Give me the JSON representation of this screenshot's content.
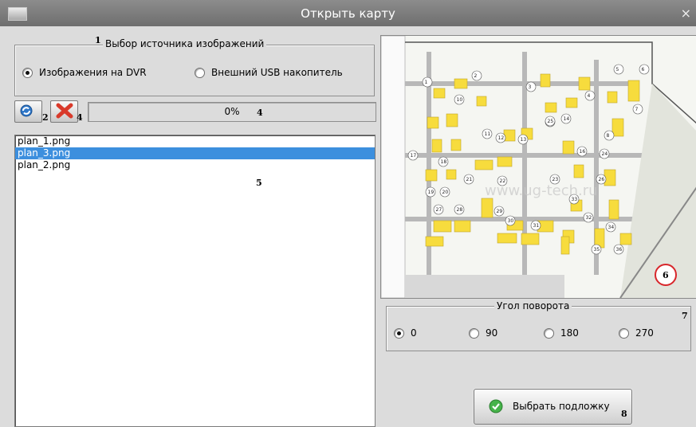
{
  "window": {
    "title": "Открыть карту",
    "close_glyph": "×"
  },
  "source_group": {
    "legend": "Выбор источника изображений",
    "marker": "1",
    "options": [
      {
        "label": "Изображения на DVR",
        "selected": true
      },
      {
        "label": "Внешний USB накопитель",
        "selected": false
      }
    ]
  },
  "toolbar": {
    "refresh_icon": "refresh-icon",
    "refresh_marker": "2",
    "delete_icon": "delete-icon",
    "delete_marker": "4"
  },
  "progress": {
    "value": 0,
    "text": "0%",
    "marker": "4"
  },
  "file_list": {
    "marker": "5",
    "items": [
      "plan_1.png",
      "plan_3.png",
      "plan_2.png"
    ],
    "selected_index": 1
  },
  "preview": {
    "marker": "6",
    "watermark": "www.ug-tech.ru",
    "plot_numbers": [
      "1",
      "2",
      "3",
      "4",
      "5",
      "6",
      "7",
      "8",
      "10",
      "11",
      "12",
      "13",
      "14",
      "15",
      "16",
      "17",
      "18",
      "19",
      "20",
      "21",
      "22",
      "23",
      "24",
      "25",
      "26",
      "27",
      "28",
      "29",
      "30",
      "31",
      "32",
      "33",
      "34",
      "35",
      "36"
    ]
  },
  "rotation_group": {
    "legend": "Угол поворота",
    "marker": "7",
    "options": [
      {
        "label": "0",
        "selected": true
      },
      {
        "label": "90",
        "selected": false
      },
      {
        "label": "180",
        "selected": false
      },
      {
        "label": "270",
        "selected": false
      }
    ]
  },
  "select_button": {
    "label": "Выбрать подложку",
    "marker": "8",
    "icon": "check-icon"
  },
  "colors": {
    "selection": "#3c8fde",
    "building": "#f5d94a",
    "marker_ring": "#d8262b",
    "check": "#46b34a"
  }
}
